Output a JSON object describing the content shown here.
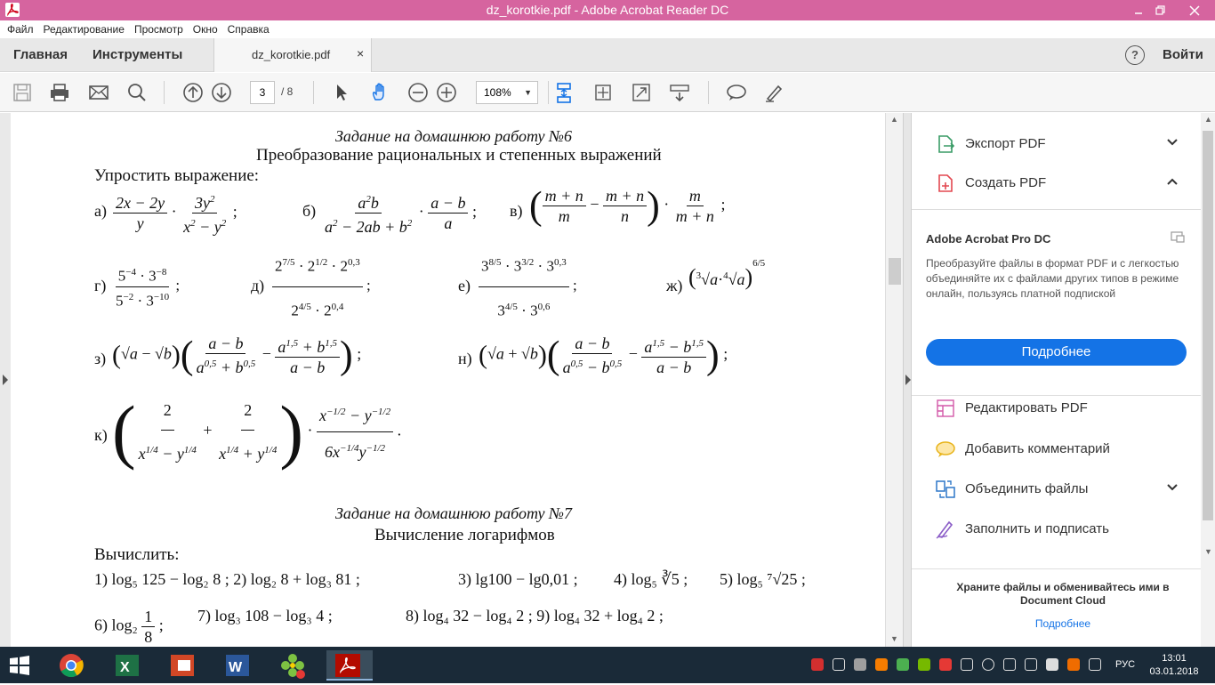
{
  "window": {
    "title": "dz_korotkie.pdf - Adobe Acrobat Reader DC"
  },
  "menu": [
    "Файл",
    "Редактирование",
    "Просмотр",
    "Окно",
    "Справка"
  ],
  "tabs": {
    "home": "Главная",
    "tools": "Инструменты",
    "doc": "dz_korotkie.pdf",
    "close": "×",
    "help": "?",
    "login": "Войти"
  },
  "toolbar": {
    "page_current": "3",
    "page_total": "/ 8",
    "zoom": "108%"
  },
  "doc": {
    "t6_title": "Задание на домашнюю  работу №6",
    "t6_sub": "Преобразование рациональных и степенных выражений",
    "t6_task": "Упростить выражение:",
    "t7_title": "Задание на домашнюю  работу №7",
    "t7_sub": "Вычисление логарифмов",
    "t7_task": "Вычислить:",
    "row1a": "а)",
    "row1b": "б)",
    "row1c": "в)",
    "row2a": "г)",
    "row2b": "д)",
    "row2c": "е)",
    "row2d": "ж)",
    "row3a": "з)",
    "row3b": "н)",
    "row4a": "к)",
    "log1": "1)  log₅ 125 − log₂ 8 ;   2)  log₂ 8 + log₃ 81 ;",
    "log2": "3)  lg100 − lg0,01 ;",
    "log3": "4)  log₅ ∛5 ;",
    "log4": "5)  log₅ ⁷√25 ;",
    "log5": "6)  log₂",
    "log6": "7)  log₃ 108 − log₃ 4 ;",
    "log7": "8)  log₄ 32 − log₄ 2 ;    9)  log₄ 32 + log₄ 2 ;"
  },
  "panel": {
    "export": "Экспорт PDF",
    "create": "Создать PDF",
    "promo_title": "Adobe Acrobat Pro DC",
    "promo_desc": "Преобразуйте файлы в формат PDF и с легкостью объединяйте их с файлами других типов в режиме онлайн, пользуясь платной подпиской",
    "promo_btn": "Подробнее",
    "edit": "Редактировать PDF",
    "comment": "Добавить комментарий",
    "combine": "Объединить файлы",
    "fill": "Заполнить и подписать",
    "cloud_text": "Храните файлы и обменивайтесь ими в Document Cloud",
    "cloud_link": "Подробнее"
  },
  "taskbar": {
    "lang": "РУС",
    "time": "13:01",
    "date": "03.01.2018"
  },
  "colors": {
    "titlebar": "#d6649f",
    "accent": "#1473e6",
    "taskbar": "#1a2a38"
  }
}
